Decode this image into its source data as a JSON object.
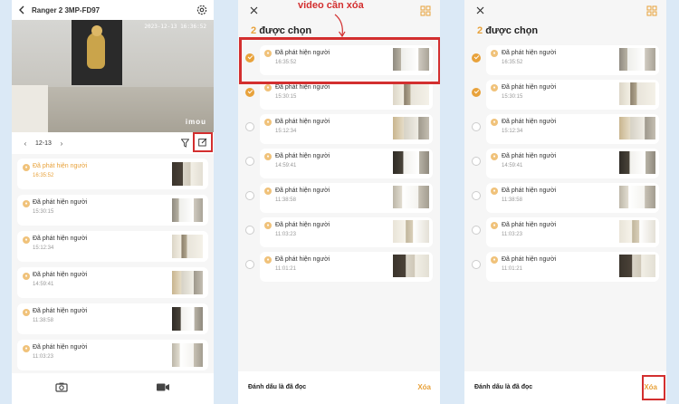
{
  "panel1": {
    "title": "Ranger 2 3MP-FD97",
    "camera_timestamp": "2023-12-13  16:36:52",
    "watermark": "imou",
    "date": "12-13",
    "events": [
      {
        "label": "Đã phát hiện người",
        "time": "16:35:52"
      },
      {
        "label": "Đã phát hiện người",
        "time": "15:30:15"
      },
      {
        "label": "Đã phát hiện người",
        "time": "15:12:34"
      },
      {
        "label": "Đã phát hiện người",
        "time": "14:59:41"
      },
      {
        "label": "Đã phát hiện người",
        "time": "11:38:58"
      },
      {
        "label": "Đã phát hiện người",
        "time": "11:03:23"
      }
    ]
  },
  "panel2": {
    "count": "2",
    "count_label": "được chọn",
    "annotation": "video cần xóa",
    "footer_mark": "Đánh dấu là đã đọc",
    "footer_delete": "Xóa",
    "items": [
      {
        "label": "Đã phát hiện người",
        "time": "16:35:52",
        "checked": true
      },
      {
        "label": "Đã phát hiện người",
        "time": "15:30:15",
        "checked": true
      },
      {
        "label": "Đã phát hiện người",
        "time": "15:12:34",
        "checked": false
      },
      {
        "label": "Đã phát hiện người",
        "time": "14:59:41",
        "checked": false
      },
      {
        "label": "Đã phát hiện người",
        "time": "11:38:58",
        "checked": false
      },
      {
        "label": "Đã phát hiện người",
        "time": "11:03:23",
        "checked": false
      },
      {
        "label": "Đã phát hiện người",
        "time": "11:01:21",
        "checked": false
      }
    ]
  },
  "panel3": {
    "count": "2",
    "count_label": "được chọn",
    "footer_mark": "Đánh dấu là đã đọc",
    "footer_delete": "Xóa",
    "items": [
      {
        "label": "Đã phát hiện người",
        "time": "16:35:52",
        "checked": true
      },
      {
        "label": "Đã phát hiện người",
        "time": "15:30:15",
        "checked": true
      },
      {
        "label": "Đã phát hiện người",
        "time": "15:12:34",
        "checked": false
      },
      {
        "label": "Đã phát hiện người",
        "time": "14:59:41",
        "checked": false
      },
      {
        "label": "Đã phát hiện người",
        "time": "11:38:58",
        "checked": false
      },
      {
        "label": "Đã phát hiện người",
        "time": "11:03:23",
        "checked": false
      },
      {
        "label": "Đã phát hiện người",
        "time": "11:01:21",
        "checked": false
      }
    ]
  },
  "colors": {
    "accent": "#e8a23b",
    "highlight": "#d32f2f",
    "background": "#dbe9f6"
  },
  "icons": [
    "back-arrow-icon",
    "gear-icon",
    "filter-icon",
    "edit-icon",
    "camera-icon",
    "video-icon",
    "close-icon",
    "grid-icon",
    "person-badge-icon"
  ]
}
